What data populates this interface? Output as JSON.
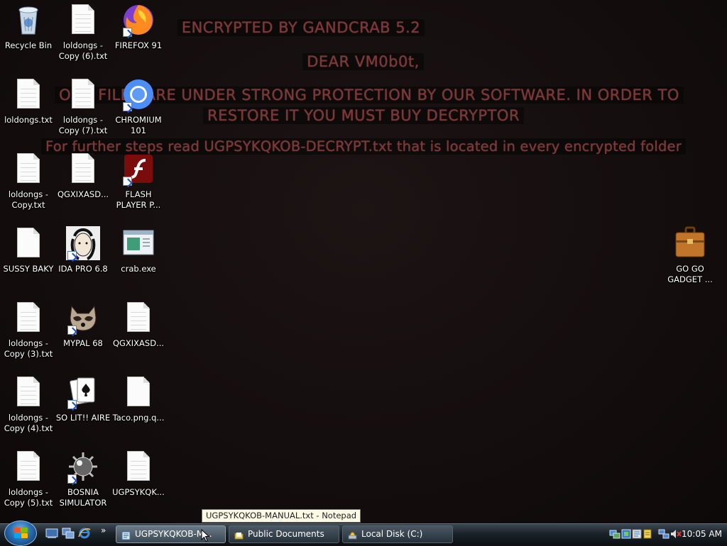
{
  "wallpaper": {
    "lines": [
      "ENCRYPTED BY GANDCRAB 5.2",
      "DEAR VM0b0t,",
      "OUR FILES ARE UNDER STRONG PROTECTION BY OUR SOFTWARE. IN ORDER TO",
      "RESTORE IT YOU MUST BUY DECRYPTOR",
      "For further steps read UGPSYKQKOB-DECRYPT.txt that is located in every encrypted folder"
    ],
    "text_color": "#7a3838"
  },
  "desktop_icons": [
    {
      "label": "Recycle Bin",
      "icon": "recycle-bin-icon"
    },
    {
      "label": "loldongs - Copy (6).txt",
      "icon": "text-file-icon"
    },
    {
      "label": "FIREFOX 91",
      "icon": "firefox-icon"
    },
    {
      "label": "loldongs.txt",
      "icon": "text-file-icon"
    },
    {
      "label": "loldongs - Copy (7).txt",
      "icon": "text-file-icon"
    },
    {
      "label": "CHROMIUM 101",
      "icon": "chromium-icon"
    },
    {
      "label": "loldongs - Copy.txt",
      "icon": "text-file-icon"
    },
    {
      "label": "QGXIXASD...",
      "icon": "text-file-icon"
    },
    {
      "label": "FLASH PLAYER P...",
      "icon": "flash-icon"
    },
    {
      "label": "SUSSY BAKY",
      "icon": "blank-file-icon"
    },
    {
      "label": "IDA PRO 6.8",
      "icon": "ida-pro-icon"
    },
    {
      "label": "crab.exe",
      "icon": "exe-window-icon"
    },
    {
      "label": "loldongs - Copy (3).txt",
      "icon": "text-file-icon"
    },
    {
      "label": "MYPAL 68",
      "icon": "raccoon-icon"
    },
    {
      "label": "QGXIXASD...",
      "icon": "text-file-icon"
    },
    {
      "label": "loldongs - Copy (4).txt",
      "icon": "text-file-icon"
    },
    {
      "label": "SO LIT!! AIRE",
      "icon": "solitaire-cards-icon"
    },
    {
      "label": "Taco.png.q...",
      "icon": "blank-file-icon"
    },
    {
      "label": "loldongs - Copy (5).txt",
      "icon": "text-file-icon"
    },
    {
      "label": "BOSNIA SIMULATOR",
      "icon": "minesweeper-mine-icon"
    },
    {
      "label": "UGPSYKQK...",
      "icon": "text-file-icon"
    },
    {
      "label": "GO GO GADGET ...",
      "icon": "briefcase-icon"
    }
  ],
  "tooltip": "UGPSYKQKOB-MANUAL.txt - Notepad",
  "taskbar": {
    "quick_launch": [
      "show-desktop-icon",
      "switch-windows-icon",
      "internet-explorer-icon"
    ],
    "overflow": "»",
    "buttons": [
      {
        "label": "UGPSYKQKOB-M...",
        "icon": "notepad-icon",
        "active": true
      },
      {
        "label": "Public Documents",
        "icon": "folder-icon",
        "active": false
      },
      {
        "label": "Local Disk (C:)",
        "icon": "drive-icon",
        "active": false
      }
    ],
    "tray_icons": [
      "network-icon",
      "tray-app-icon",
      "tray-app-icon-2",
      "tray-app-icon-3",
      "network-status-icon",
      "volume-muted-icon"
    ],
    "clock": "10:05 AM"
  }
}
